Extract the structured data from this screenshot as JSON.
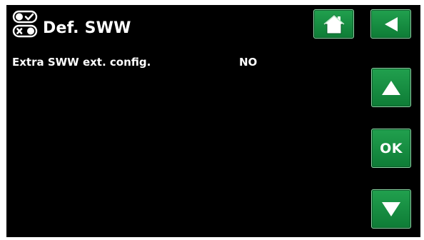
{
  "header": {
    "title": "Def. SWW",
    "title_icon": "toggle-switches-icon"
  },
  "navigation": {
    "home_icon": "home-icon",
    "back_icon": "back-arrow-icon",
    "up_icon": "up-arrow-icon",
    "ok_label": "OK",
    "down_icon": "down-arrow-icon"
  },
  "settings": {
    "rows": [
      {
        "label": "Extra SWW ext. config.",
        "value": "NO"
      }
    ]
  },
  "colors": {
    "background": "#000000",
    "button_green": "#1a9a47",
    "text": "#ffffff"
  }
}
